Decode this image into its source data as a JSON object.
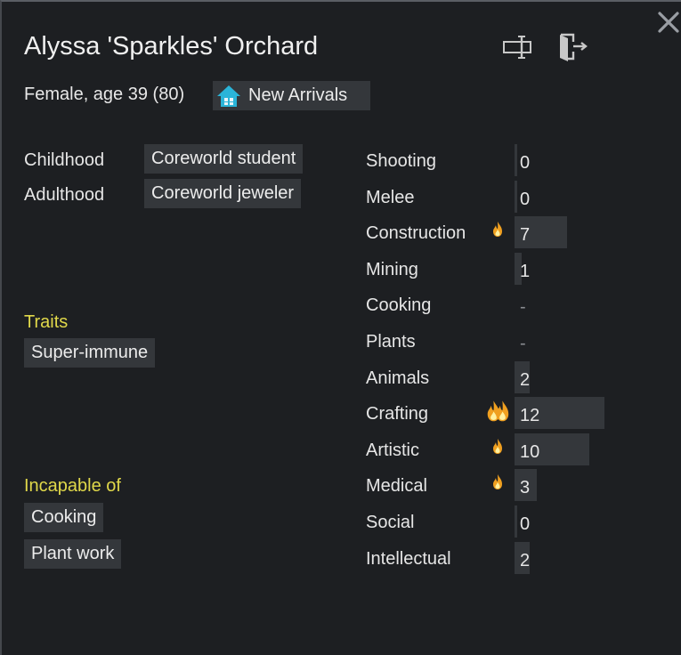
{
  "window": {
    "title": "Alyssa 'Sparkles' Orchard",
    "subtitle": "Female, age 39 (80)",
    "faction": "New Arrivals",
    "close_icon": "close-icon",
    "rename_icon": "rename-icon",
    "banish_icon": "exit-door-icon"
  },
  "backstory": {
    "childhood_label": "Childhood",
    "childhood_value": "Coreworld student",
    "adulthood_label": "Adulthood",
    "adulthood_value": "Coreworld jeweler"
  },
  "traits": {
    "heading": "Traits",
    "items": [
      "Super-immune"
    ]
  },
  "incapable": {
    "heading": "Incapable of",
    "items": [
      "Cooking",
      "Plant work"
    ]
  },
  "skills": [
    {
      "name": "Shooting",
      "level": "0",
      "passion": "none"
    },
    {
      "name": "Melee",
      "level": "0",
      "passion": "none"
    },
    {
      "name": "Construction",
      "level": "7",
      "passion": "minor"
    },
    {
      "name": "Mining",
      "level": "1",
      "passion": "none"
    },
    {
      "name": "Cooking",
      "level": "-",
      "passion": "none"
    },
    {
      "name": "Plants",
      "level": "-",
      "passion": "none"
    },
    {
      "name": "Animals",
      "level": "2",
      "passion": "none"
    },
    {
      "name": "Crafting",
      "level": "12",
      "passion": "major"
    },
    {
      "name": "Artistic",
      "level": "10",
      "passion": "minor"
    },
    {
      "name": "Medical",
      "level": "3",
      "passion": "minor"
    },
    {
      "name": "Social",
      "level": "0",
      "passion": "none"
    },
    {
      "name": "Intellectual",
      "level": "2",
      "passion": "none"
    }
  ],
  "colors": {
    "background": "#1d1f22",
    "chip": "#34373b",
    "heading": "#e0d84a",
    "flame": "#f0a020"
  }
}
